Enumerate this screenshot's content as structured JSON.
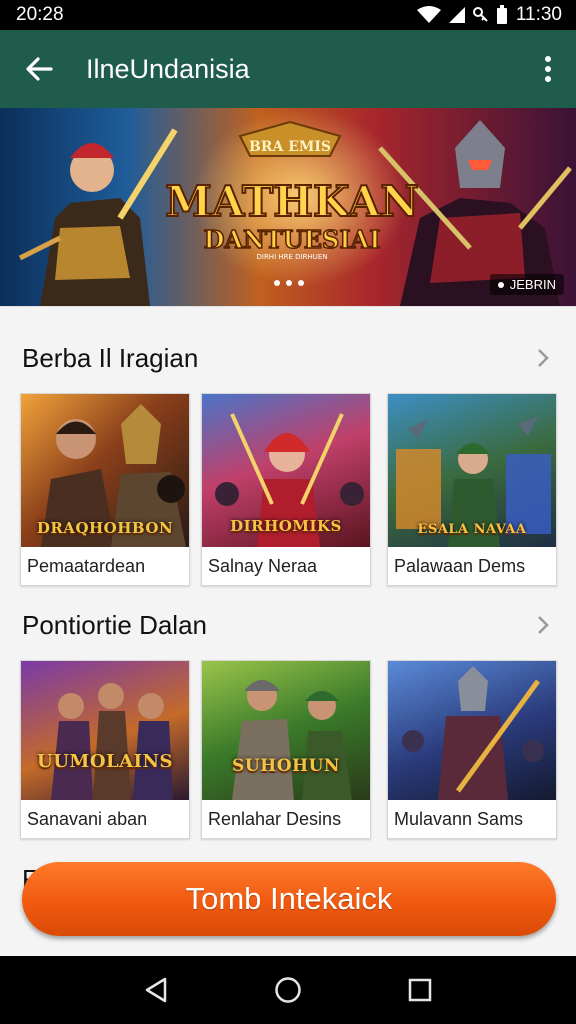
{
  "status_bar": {
    "left_time": "20:28",
    "right_time": "11:30"
  },
  "app_bar": {
    "title": "IlneUndanisia",
    "back_icon": "arrow-left-icon",
    "menu_icon": "more-vert-icon"
  },
  "banner": {
    "title_top": "BRA  EMIS",
    "title_main": "MATHKAN",
    "title_sub": "DANTUESIAI",
    "title_small": "DIRHI HRE DIRHUEN",
    "tag": "JEBRIN",
    "page_count": 3,
    "accent": "#f6c445"
  },
  "sections": [
    {
      "title": "Berba Il Iragian",
      "cards": [
        {
          "art_title": "DRAQHOHBON",
          "label": "Pemaatardean"
        },
        {
          "art_title": "DIRHOMIKS",
          "label": "Salnay Neraa"
        },
        {
          "art_title": "ESALA NAVAA",
          "label": "Palawaan Dems"
        }
      ]
    },
    {
      "title": "Pontiortie Dalan",
      "cards": [
        {
          "art_title": "UUMOLAINS",
          "label": "Sanavani aban"
        },
        {
          "art_title": "SUHOHUN",
          "label": "Renlahar Desins"
        },
        {
          "art_title": "",
          "label": "Mulavann Sams"
        }
      ]
    }
  ],
  "partial_section_title": "F",
  "cta": {
    "label": "Tomb Intekaick",
    "color": "#f05a10"
  },
  "colors": {
    "app_bar": "#1f5c4c",
    "status_bar": "#000000",
    "nav_bar": "#000000"
  }
}
